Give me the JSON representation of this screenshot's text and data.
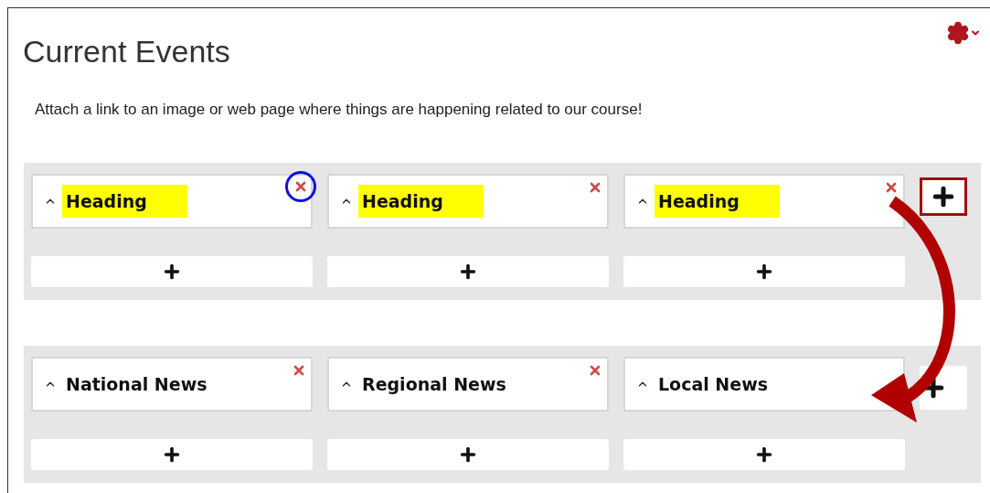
{
  "title": "Current Events",
  "description": "Attach a link to an image or web page where things are happening related to our course!",
  "boards": [
    {
      "add_column_highlighted": true,
      "columns": [
        {
          "heading": "Heading",
          "highlighted": true,
          "delete_visible": true,
          "delete_circled": true
        },
        {
          "heading": "Heading",
          "highlighted": true,
          "delete_visible": true,
          "delete_circled": false
        },
        {
          "heading": "Heading",
          "highlighted": true,
          "delete_visible": true,
          "delete_circled": false
        }
      ]
    },
    {
      "add_column_highlighted": false,
      "columns": [
        {
          "heading": "National News",
          "highlighted": false,
          "delete_visible": true,
          "delete_circled": false
        },
        {
          "heading": "Regional News",
          "highlighted": false,
          "delete_visible": true,
          "delete_circled": false
        },
        {
          "heading": "Local News",
          "highlighted": false,
          "delete_visible": false
        }
      ]
    }
  ]
}
